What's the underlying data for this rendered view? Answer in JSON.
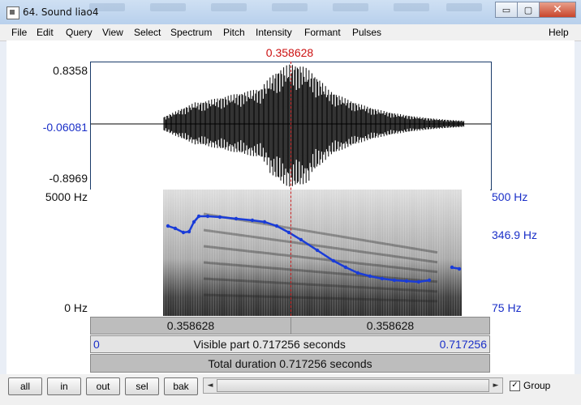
{
  "window": {
    "title": "64. Sound liao4",
    "minimize": "▭",
    "maximize": "▢",
    "close": "✕"
  },
  "menu": [
    "File",
    "Edit",
    "Query",
    "View",
    "Select",
    "Spectrum",
    "Pitch",
    "Intensity",
    "Formant",
    "Pulses"
  ],
  "help": "Help",
  "cursor_time": "0.358628",
  "waveform": {
    "y_max": "0.8358",
    "y_cursor": "-0.06081",
    "y_min": "-0.8969"
  },
  "spectrogram": {
    "freq_top": "5000 Hz",
    "freq_bottom": "0 Hz"
  },
  "pitch_axis": {
    "top": "500 Hz",
    "cursor_value": "346.9 Hz",
    "bottom": "75 Hz"
  },
  "time_bar": {
    "left": "0.358628",
    "right": "0.358628"
  },
  "visible_bar": {
    "start": "0",
    "label": "Visible part 0.717256 seconds",
    "end": "0.717256"
  },
  "total_bar": {
    "label": "Total duration 0.717256 seconds"
  },
  "buttons": {
    "all": "all",
    "in": "in",
    "out": "out",
    "sel": "sel",
    "bak": "bak"
  },
  "scroll": {
    "left": "◄",
    "right": "►"
  },
  "group": {
    "label": "Group",
    "checked": "✓"
  },
  "colors": {
    "cursor": "#cc1010",
    "pitch": "#1a3cd8",
    "axis_blue": "#1a2fc8"
  }
}
